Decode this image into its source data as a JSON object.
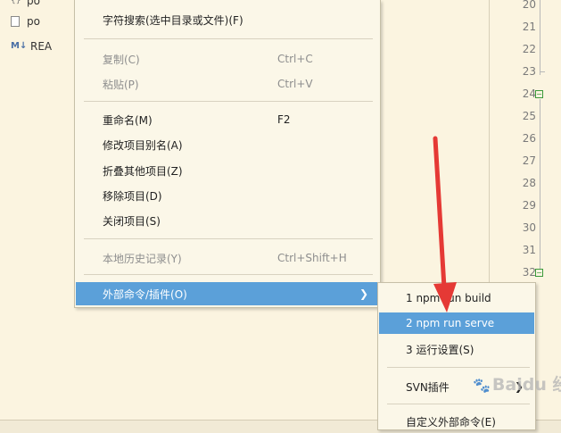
{
  "sidebar": {
    "files": [
      {
        "label": "po",
        "icon": "file-icon"
      },
      {
        "label": "po",
        "icon": "document-icon"
      },
      {
        "label": "REA",
        "icon": "markdown-icon",
        "badge": "M↓"
      }
    ]
  },
  "editor": {
    "line_numbers": [
      "20",
      "21",
      "22",
      "23",
      "24",
      "25",
      "26",
      "27",
      "28",
      "29",
      "30",
      "31",
      "32"
    ],
    "fold_marker": "⊟"
  },
  "context_menu": {
    "items": [
      {
        "label": "字符搜索(选中目录或文件)(F)",
        "shortcut": ""
      },
      {
        "label": "复制(C)",
        "shortcut": "Ctrl+C"
      },
      {
        "label": "粘贴(P)",
        "shortcut": "Ctrl+V"
      },
      {
        "label": "重命名(M)",
        "shortcut": "F2"
      },
      {
        "label": "修改项目别名(A)",
        "shortcut": ""
      },
      {
        "label": "折叠其他项目(Z)",
        "shortcut": ""
      },
      {
        "label": "移除项目(D)",
        "shortcut": ""
      },
      {
        "label": "关闭项目(S)",
        "shortcut": ""
      },
      {
        "label": "本地历史记录(Y)",
        "shortcut": "Ctrl+Shift+H"
      },
      {
        "label": "外部命令/插件(O)",
        "submenu_arrow": "❯"
      }
    ]
  },
  "submenu": {
    "items": [
      {
        "label": "1 npm run build"
      },
      {
        "label": "2 npm run serve"
      },
      {
        "label": "3 运行设置(S)"
      },
      {
        "label": "SVN插件",
        "submenu_arrow": "❯"
      },
      {
        "label": "自定义外部命令(E)"
      }
    ]
  },
  "annotation": {
    "arrow_color": "#e53935"
  },
  "watermark": {
    "text": "Baidu 经验"
  }
}
